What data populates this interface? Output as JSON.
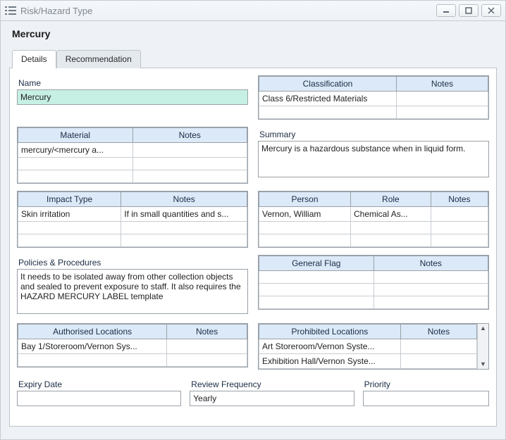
{
  "window": {
    "title": "Risk/Hazard Type"
  },
  "page_title": "Mercury",
  "tabs": {
    "details": "Details",
    "recommendation": "Recommendation"
  },
  "labels": {
    "name": "Name",
    "summary": "Summary",
    "policies": "Policies & Procedures",
    "expiry": "Expiry Date",
    "review": "Review Frequency",
    "priority": "Priority"
  },
  "fields": {
    "name": "Mercury",
    "summary": "Mercury is a hazardous substance when in liquid form.",
    "policies": "It needs to be isolated away from other collection objects and sealed to prevent exposure to staff. It also requires the HAZARD MERCURY LABEL template",
    "expiry": "",
    "review": "Yearly",
    "priority": ""
  },
  "classification": {
    "headers": [
      "Classification",
      "Notes"
    ],
    "rows": [
      [
        "Class 6/Restricted Materials",
        ""
      ],
      [
        "",
        ""
      ]
    ]
  },
  "material": {
    "headers": [
      "Material",
      "Notes"
    ],
    "rows": [
      [
        "mercury/<mercury a...",
        ""
      ],
      [
        "",
        ""
      ],
      [
        "",
        ""
      ]
    ]
  },
  "impact": {
    "headers": [
      "Impact Type",
      "Notes"
    ],
    "rows": [
      [
        "Skin irritation",
        "If in small quantities and s..."
      ],
      [
        "",
        ""
      ],
      [
        "",
        ""
      ]
    ]
  },
  "person": {
    "headers": [
      "Person",
      "Role",
      "Notes"
    ],
    "rows": [
      [
        "Vernon, William",
        "Chemical As...",
        ""
      ],
      [
        "",
        "",
        ""
      ],
      [
        "",
        "",
        ""
      ]
    ]
  },
  "generalflag": {
    "headers": [
      "General Flag",
      "Notes"
    ],
    "rows": [
      [
        "",
        ""
      ],
      [
        "",
        ""
      ],
      [
        "",
        ""
      ]
    ]
  },
  "authloc": {
    "headers": [
      "Authorised Locations",
      "Notes"
    ],
    "rows": [
      [
        "Bay 1/Storeroom/Vernon Sys...",
        ""
      ],
      [
        "",
        ""
      ]
    ]
  },
  "prohloc": {
    "headers": [
      "Prohibited Locations",
      "Notes"
    ],
    "rows": [
      [
        "Art Storeroom/Vernon Syste...",
        ""
      ],
      [
        "Exhibition Hall/Vernon Syste...",
        ""
      ]
    ]
  }
}
